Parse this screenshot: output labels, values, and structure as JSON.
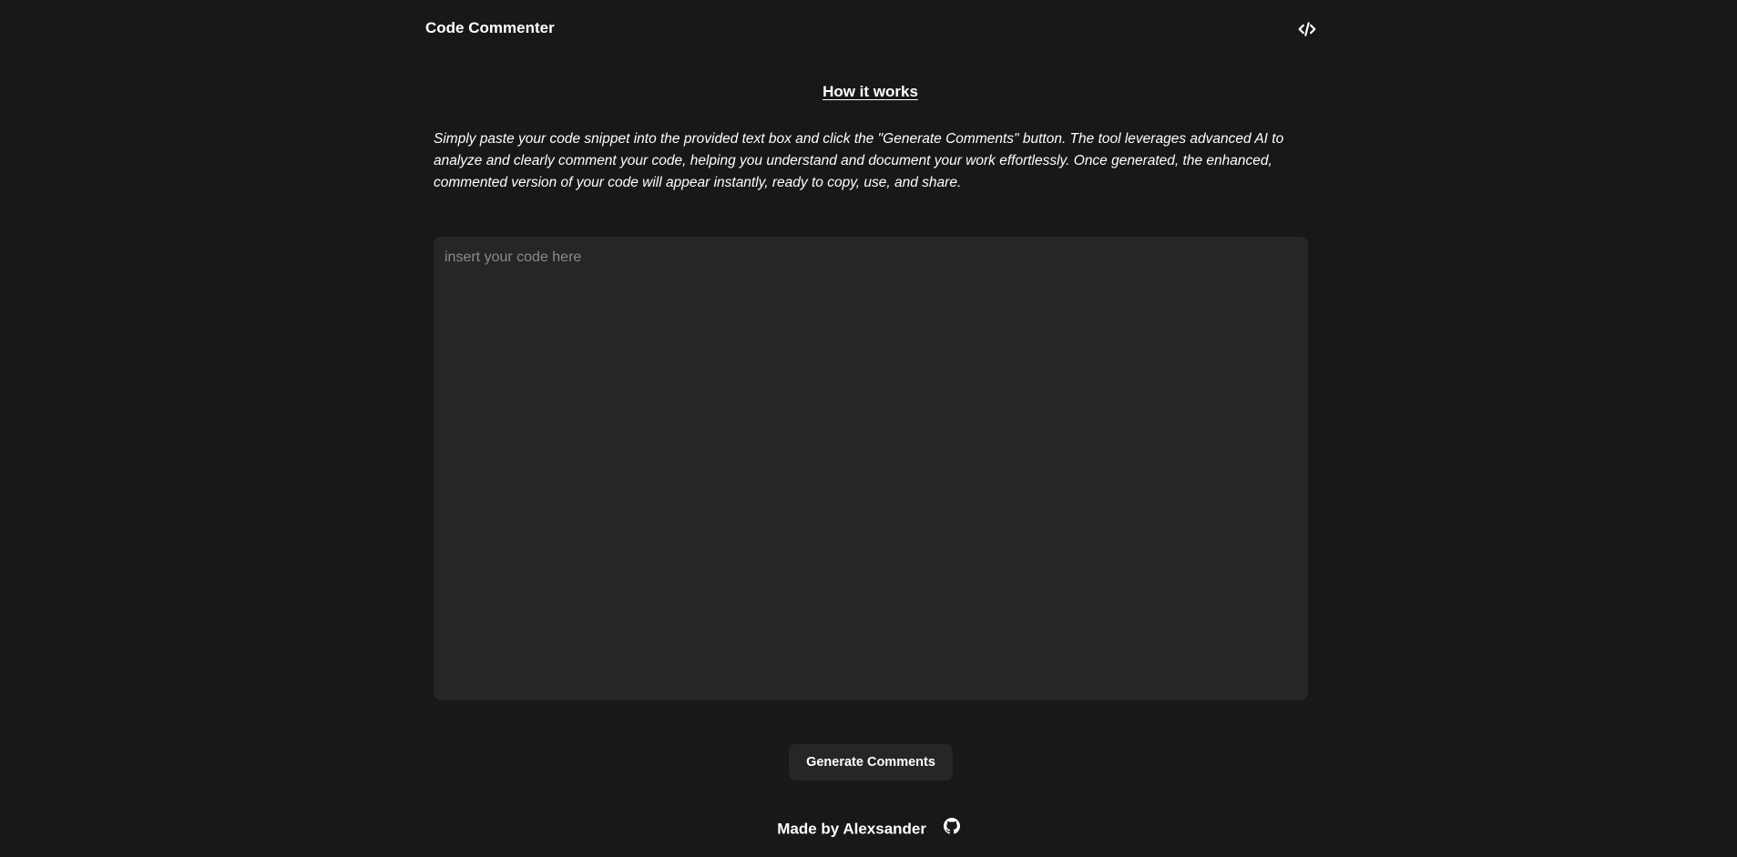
{
  "header": {
    "title": "Code Commenter",
    "icon": "code-icon"
  },
  "main": {
    "heading": "How it works",
    "description": "Simply paste your code snippet into the provided text box and click the \"Generate Comments\" button. The tool leverages advanced AI to analyze and clearly comment your code, helping you understand and document your work effortlessly. Once generated, the enhanced, commented version of your code will appear instantly, ready to copy, use, and share.",
    "code_input": {
      "value": "",
      "placeholder": "insert your code here"
    },
    "generate_button": "Generate Comments"
  },
  "footer": {
    "text": "Made by Alexsander",
    "icon": "github-icon"
  },
  "colors": {
    "background": "#181818",
    "surface": "#262626",
    "text": "#ffffff"
  }
}
